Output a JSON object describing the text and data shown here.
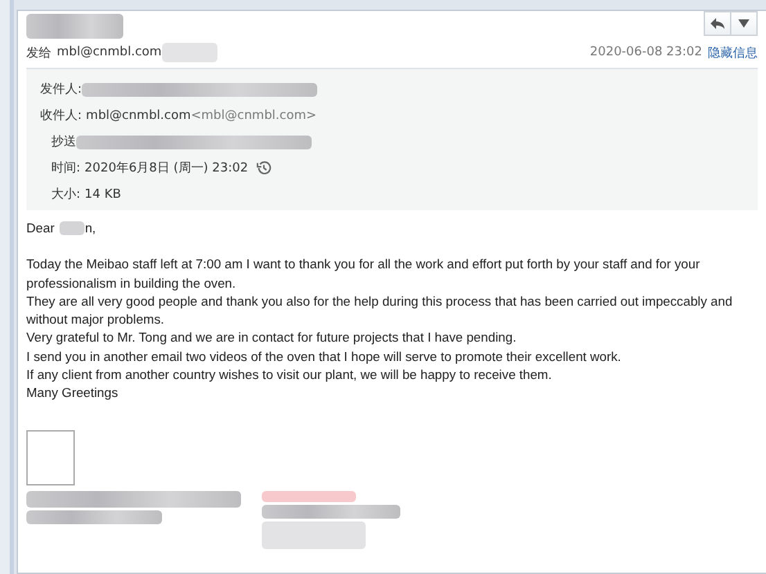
{
  "header": {
    "to_label": "发给",
    "to_address": "mbl@cnmbl.com",
    "date": "2020-06-08 23:02",
    "hide_link": "隐藏信息"
  },
  "details": [
    {
      "kind": "sender",
      "label": "发件人:"
    },
    {
      "kind": "recipient",
      "label": "收件人:",
      "value": "mbl@cnmbl.com",
      "extra": "<mbl@cnmbl.com>"
    },
    {
      "kind": "cc",
      "label": "抄送"
    },
    {
      "kind": "time",
      "label": "时间:",
      "value": "2020年6月8日 (周一) 23:02"
    },
    {
      "kind": "size",
      "label": "大小:",
      "value": "14 KB"
    }
  ],
  "body": {
    "greeting_start": "Dear",
    "greeting_end": "n,",
    "lines": [
      "Today the Meibao staff left at 7:00 am I want to thank you for all the work and effort put forth by your staff and for your professionalism in building the oven.",
      "They are all very good people and thank you also for the help during this process that has been carried out impeccably and without major problems.",
      "Very grateful to Mr. Tong and we are in contact for future projects that I have pending.",
      "I send you in another email two videos of the oven that I hope will serve to promote their excellent work.",
      "If any client from another country wishes to visit our plant, we will be happy to receive them.",
      "Many Greetings"
    ]
  }
}
